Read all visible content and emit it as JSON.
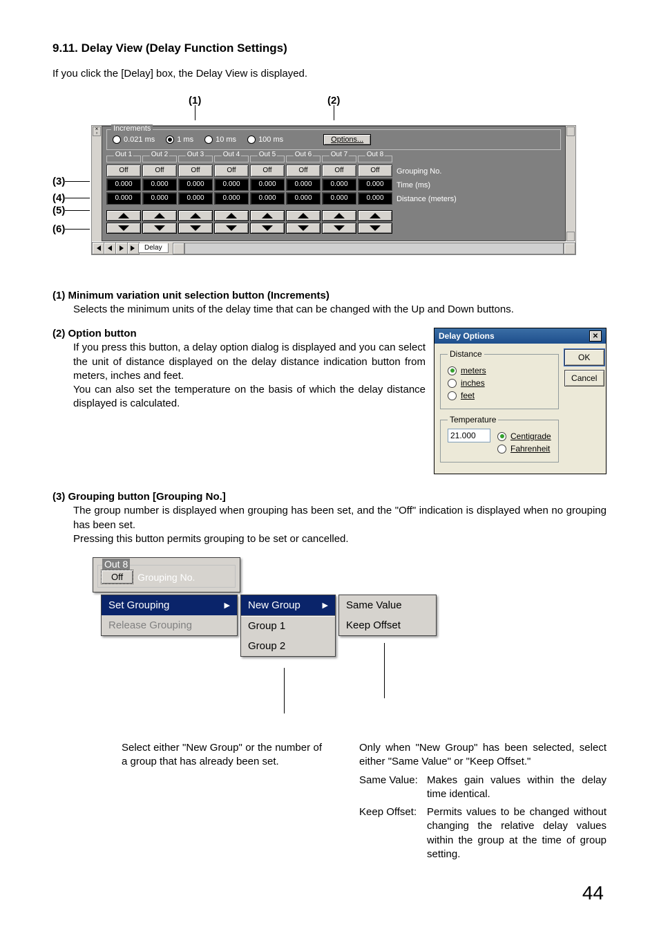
{
  "heading": "9.11. Delay View (Delay Function Settings)",
  "intro": "If you click the [Delay] box, the Delay View is displayed.",
  "callouts_top": {
    "c1": "(1)",
    "c2": "(2)"
  },
  "callouts_left": {
    "c3": "(3)",
    "c4": "(4)",
    "c5": "(5)",
    "c6": "(6)"
  },
  "delay_view": {
    "increments_legend": "Increments",
    "increments": [
      "0.021 ms",
      "1 ms",
      "10 ms",
      "100 ms"
    ],
    "increments_selected_index": 1,
    "options_btn": "Options...",
    "out_labels": [
      "Out 1",
      "Out 2",
      "Out 3",
      "Out 4",
      "Out 5",
      "Out 6",
      "Out 7",
      "Out 8"
    ],
    "row_labels": {
      "grouping": "Grouping No.",
      "time": "Time (ms)",
      "distance": "Distance (meters)"
    },
    "grouping_row": [
      "Off",
      "Off",
      "Off",
      "Off",
      "Off",
      "Off",
      "Off",
      "Off"
    ],
    "time_row": [
      "0.000",
      "0.000",
      "0.000",
      "0.000",
      "0.000",
      "0.000",
      "0.000",
      "0.000"
    ],
    "distance_row": [
      "0.000",
      "0.000",
      "0.000",
      "0.000",
      "0.000",
      "0.000",
      "0.000",
      "0.000"
    ],
    "tab_label": "Delay"
  },
  "item1": {
    "h": "(1) Minimum variation unit selection button (Increments)",
    "b": "Selects the minimum units of the delay time that can be changed with the Up and Down buttons."
  },
  "item2": {
    "h": "(2) Option button",
    "p1": "If you press this button, a delay option dialog is displayed and you can select the unit of distance displayed on the delay distance indication button from meters, inches and feet.",
    "p2": "You can also set the temperature on the basis of which the delay distance displayed is calculated."
  },
  "dlg": {
    "title": "Delay Options",
    "close": "✕",
    "distance_legend": "Distance",
    "distance_options": [
      "meters",
      "inches",
      "feet"
    ],
    "distance_selected_index": 0,
    "temperature_legend": "Temperature",
    "temperature_value": "21.000",
    "temp_options": [
      "Centigrade",
      "Fahrenheit"
    ],
    "temp_selected_index": 0,
    "ok": "OK",
    "cancel": "Cancel"
  },
  "item3": {
    "h": "(3) Grouping button [Grouping No.]",
    "p1": "The group number is displayed when grouping has been set, and the \"Off\" indication is displayed when no grouping has been set.",
    "p2": "Pressing this button permits grouping to be set or cancelled."
  },
  "ctx": {
    "out8": {
      "legend": "Out 8",
      "off": "Off",
      "gno": "Grouping No."
    },
    "menu1": {
      "set": "Set Grouping",
      "release": "Release Grouping"
    },
    "menu2": {
      "newg": "New Group",
      "g1": "Group 1",
      "g2": "Group 2"
    },
    "menu3": {
      "same": "Same Value",
      "keep": "Keep Offset"
    }
  },
  "annot": {
    "left": "Select either \"New Group\" or the number of a group that has already been set.",
    "right_intro": "Only when \"New Group\" has been selected, select either \"Same Value\" or \"Keep Offset.\"",
    "kv": [
      {
        "k": "Same Value:",
        "v": "Makes gain values within the delay time identical."
      },
      {
        "k": "Keep Offset:",
        "v": "Permits values to be changed without changing the relative delay values within the group at the time of group setting."
      }
    ]
  },
  "page_number": "44"
}
